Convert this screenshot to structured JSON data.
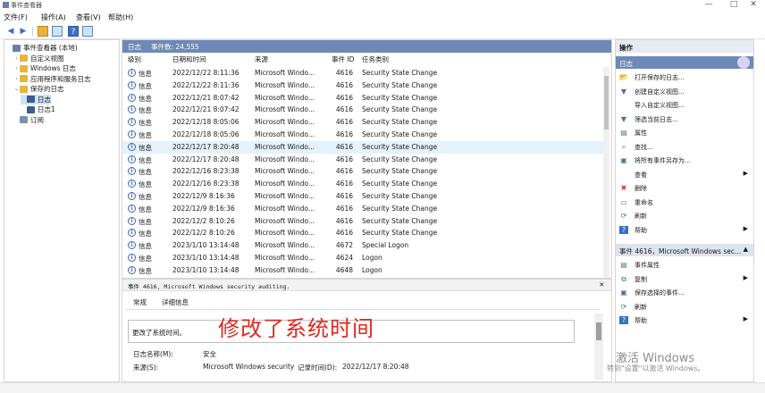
{
  "window": {
    "title": "事件查看器",
    "minimize": "—",
    "maximize": "□",
    "close": "✕"
  },
  "menu": [
    "文件(F)",
    "操作(A)",
    "查看(V)",
    "帮助(H)"
  ],
  "toolbar": {
    "back": "◀",
    "forward": "▶"
  },
  "tree": [
    {
      "label": "事件查看器 (本地)",
      "indent": 0,
      "twisty": "",
      "icon": "viewer-icon",
      "color": "#6b7da8"
    },
    {
      "label": "自定义视图",
      "indent": 1,
      "twisty": "›",
      "icon": "folder-icon",
      "color": "#e8b43a"
    },
    {
      "label": "Windows 日志",
      "indent": 1,
      "twisty": "›",
      "icon": "folder-icon",
      "color": "#e8b43a"
    },
    {
      "label": "应用程序和服务日志",
      "indent": 1,
      "twisty": "›",
      "icon": "folder-icon",
      "color": "#e8b43a"
    },
    {
      "label": "保存的日志",
      "indent": 1,
      "twisty": "⌄",
      "icon": "folder-open-icon",
      "color": "#e8b43a"
    },
    {
      "label": "日志",
      "indent": 2,
      "twisty": "",
      "icon": "log-icon",
      "color": "#3a5d8f",
      "selected": true
    },
    {
      "label": "日志1",
      "indent": 2,
      "twisty": "",
      "icon": "log-icon",
      "color": "#3a5d8f"
    },
    {
      "label": "订阅",
      "indent": 1,
      "twisty": "",
      "icon": "subscription-icon",
      "color": "#7a8fb0"
    }
  ],
  "list": {
    "pane_title": "日志",
    "event_count": "事件数: 24,555",
    "columns": [
      "级别",
      "日期和时间",
      "来源",
      "事件 ID",
      "任务类别"
    ],
    "rows": [
      [
        "信息",
        "2022/12/22 8:11:36",
        "Microsoft Windo...",
        "4616",
        "Security State Change"
      ],
      [
        "信息",
        "2022/12/22 8:11:36",
        "Microsoft Windo...",
        "4616",
        "Security State Change"
      ],
      [
        "信息",
        "2022/12/21 8:07:42",
        "Microsoft Windo...",
        "4616",
        "Security State Change"
      ],
      [
        "信息",
        "2022/12/21 8:07:42",
        "Microsoft Windo...",
        "4616",
        "Security State Change"
      ],
      [
        "信息",
        "2022/12/18 8:05:06",
        "Microsoft Windo...",
        "4616",
        "Security State Change"
      ],
      [
        "信息",
        "2022/12/18 8:05:06",
        "Microsoft Windo...",
        "4616",
        "Security State Change"
      ],
      [
        "信息",
        "2022/12/17 8:20:48",
        "Microsoft Windo...",
        "4616",
        "Security State Change"
      ],
      [
        "信息",
        "2022/12/17 8:20:48",
        "Microsoft Windo...",
        "4616",
        "Security State Change"
      ],
      [
        "信息",
        "2022/12/16 8:23:38",
        "Microsoft Windo...",
        "4616",
        "Security State Change"
      ],
      [
        "信息",
        "2022/12/16 8:23:38",
        "Microsoft Windo...",
        "4616",
        "Security State Change"
      ],
      [
        "信息",
        "2022/12/9 8:16:36",
        "Microsoft Windo...",
        "4616",
        "Security State Change"
      ],
      [
        "信息",
        "2022/12/9 8:16:36",
        "Microsoft Windo...",
        "4616",
        "Security State Change"
      ],
      [
        "信息",
        "2022/12/2 8:10:26",
        "Microsoft Windo...",
        "4616",
        "Security State Change"
      ],
      [
        "信息",
        "2022/12/2 8:10:26",
        "Microsoft Windo...",
        "4616",
        "Security State Change"
      ],
      [
        "信息",
        "2023/1/10 13:14:48",
        "Microsoft Windo...",
        "4672",
        "Special Logon"
      ],
      [
        "信息",
        "2023/1/10 13:14:48",
        "Microsoft Windo...",
        "4624",
        "Logon"
      ],
      [
        "信息",
        "2023/1/10 13:14:48",
        "Microsoft Windo...",
        "4648",
        "Logon"
      ]
    ],
    "selected_row": 6
  },
  "detail": {
    "header": "事件 4616, Microsoft Windows security auditing.",
    "close": "✕",
    "tabs": [
      "常规",
      "详细信息"
    ],
    "description": "更改了系统时间。",
    "annotation": "修改了系统时间",
    "fields": {
      "log_name_label": "日志名称(M):",
      "log_name_value": "安全",
      "source_label": "来源(S):",
      "source_value": "Microsoft Windows security",
      "recorded_label": "记录时间(D):",
      "recorded_value": "2022/12/17 8:20:48"
    }
  },
  "actions": {
    "header": "操作",
    "section1": "日志",
    "items1": [
      {
        "label": "打开保存的日志...",
        "icon": "open-icon",
        "glyph": "📂",
        "arrow": ""
      },
      {
        "label": "创建自定义视图...",
        "icon": "filter-icon",
        "glyph": "▼",
        "arrow": ""
      },
      {
        "label": "导入自定义视图...",
        "icon": "import-icon",
        "glyph": "",
        "arrow": ""
      },
      {
        "label": "筛选当前日志...",
        "icon": "filter-icon",
        "glyph": "▼",
        "arrow": ""
      },
      {
        "label": "属性",
        "icon": "properties-icon",
        "glyph": "▤",
        "arrow": ""
      },
      {
        "label": "查找...",
        "icon": "find-icon",
        "glyph": "⌕",
        "arrow": ""
      },
      {
        "label": "将所有事件另存为...",
        "icon": "save-icon",
        "glyph": "▣",
        "arrow": ""
      },
      {
        "label": "查看",
        "icon": "view-icon",
        "glyph": "",
        "arrow": "▶"
      },
      {
        "label": "删除",
        "icon": "delete-icon",
        "glyph": "✖",
        "arrow": ""
      },
      {
        "label": "重命名",
        "icon": "rename-icon",
        "glyph": "▭",
        "arrow": ""
      },
      {
        "label": "刷新",
        "icon": "refresh-icon",
        "glyph": "⟳",
        "arrow": ""
      },
      {
        "label": "帮助",
        "icon": "help-icon",
        "glyph": "?",
        "arrow": "▶"
      }
    ],
    "section2": "事件 4616，Microsoft Windows sec...",
    "items2": [
      {
        "label": "事件属性",
        "icon": "event-properties-icon",
        "glyph": "▤",
        "arrow": ""
      },
      {
        "label": "复制",
        "icon": "copy-icon",
        "glyph": "⧉",
        "arrow": "▶"
      },
      {
        "label": "保存选择的事件...",
        "icon": "save-icon",
        "glyph": "▣",
        "arrow": ""
      },
      {
        "label": "刷新",
        "icon": "refresh-icon",
        "glyph": "⟳",
        "arrow": ""
      },
      {
        "label": "帮助",
        "icon": "help-icon",
        "glyph": "?",
        "arrow": "▶"
      }
    ]
  },
  "watermark": {
    "line1": "激活 Windows",
    "line2": "转到\"设置\"以激活 Windows。"
  }
}
